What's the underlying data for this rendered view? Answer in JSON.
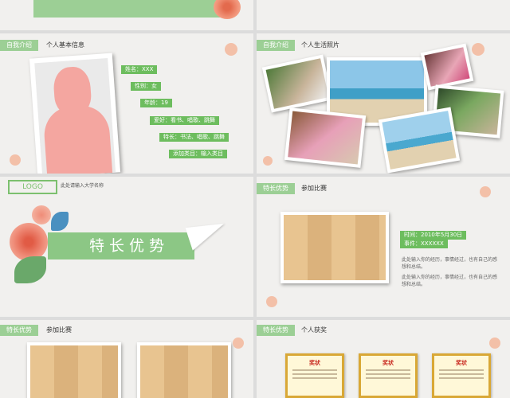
{
  "slides": {
    "s3": {
      "tag": "自我介绍",
      "heading": "个人基本信息",
      "fields": [
        "姓名：XXX",
        "性别：女",
        "年龄：19",
        "爱好：看书、唱歌、跳舞",
        "特长：书法、唱歌、跳舞",
        "添加类目：输入类目"
      ]
    },
    "s4": {
      "tag": "自我介绍",
      "heading": "个人生活照片"
    },
    "s5": {
      "logo": "LOGO",
      "subtitle": "此处请输入大学名称",
      "title": "特长优势"
    },
    "s6": {
      "tag": "特长优势",
      "heading": "参加比赛",
      "time_label": "时间：2010年5月30日",
      "event_label": "事件：XXXXXX",
      "desc1": "此处输入你的经历，事情经过，也有自己的感想和总结。",
      "desc2": "此处输入你的经历，事情经过，也有自己的感想和总结。"
    },
    "s7": {
      "tag": "特长优势",
      "heading": "参加比赛"
    },
    "s8": {
      "tag": "特长优势",
      "heading": "个人获奖",
      "cert_title": "奖状"
    }
  },
  "colors": {
    "accent": "#6dbd5e",
    "tag": "#9ccf95",
    "person": "#f4a6a0"
  }
}
